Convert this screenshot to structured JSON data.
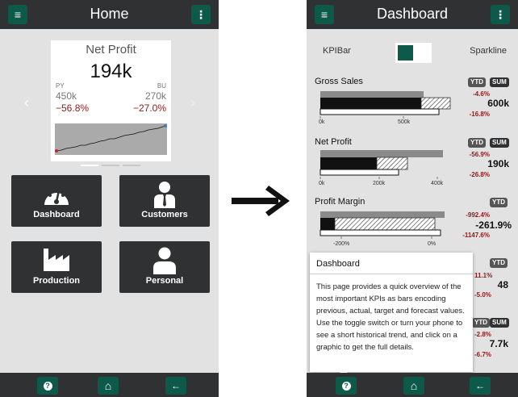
{
  "home": {
    "title": "Home",
    "menu_icon": "≡",
    "more_icon": "⋮",
    "card": {
      "title": "Net Profit",
      "value": "194k",
      "py_label": "PY",
      "bu_label": "BU",
      "py_value": "450k",
      "bu_value": "270k",
      "py_pct": "−56.8%",
      "bu_pct": "−27.0%"
    },
    "prev_icon": "‹",
    "next_icon": "›",
    "tiles": [
      {
        "label": "Dashboard"
      },
      {
        "label": "Customers"
      },
      {
        "label": "Production"
      },
      {
        "label": "Personal"
      }
    ],
    "footer": {
      "help_icon": "?",
      "home_icon": "⌂",
      "back_icon": "←"
    }
  },
  "dash": {
    "title": "Dashboard",
    "menu_icon": "≡",
    "more_icon": "⋮",
    "kpibar_label": "KPIBar",
    "sparkline_label": "Sparkline",
    "kpis": [
      {
        "name": "Gross Sales",
        "badges": [
          "YTD",
          "SUM"
        ],
        "pct1": "-4.6%",
        "value": "600k",
        "pct2": "-16.8%",
        "ticks": [
          "0k",
          "500k"
        ]
      },
      {
        "name": "Net Profit",
        "badges": [
          "YTD",
          "SUM"
        ],
        "pct1": "-56.9%",
        "value": "190k",
        "pct2": "-26.8%",
        "ticks": [
          "0k",
          "200k",
          "400k"
        ]
      },
      {
        "name": "Profit Margin",
        "badges": [
          "YTD"
        ],
        "pct1": "-992.4%",
        "value": "-261.9%",
        "pct2": "-1147.6%",
        "ticks": [
          "-200%",
          "0%"
        ]
      },
      {
        "name": "",
        "badges": [
          "YTD"
        ],
        "pct1": "11.1%",
        "value": "48",
        "pct2": "-5.0%"
      },
      {
        "name": "",
        "badges": [
          "YTD",
          "SUM"
        ],
        "pct1": "-2.8%",
        "value": "7.7k",
        "pct2": "-6.7%"
      }
    ],
    "popup": {
      "title": "Dashboard",
      "body": "This page provides a quick overview of the most important KPIs as bars encoding previous, actual, target and forecast values. Use the toggle switch or turn your phone to see a short historical trend, and click on a graphic to get the full details."
    },
    "footer": {
      "help_icon": "?",
      "home_icon": "⌂",
      "back_icon": "←"
    }
  }
}
